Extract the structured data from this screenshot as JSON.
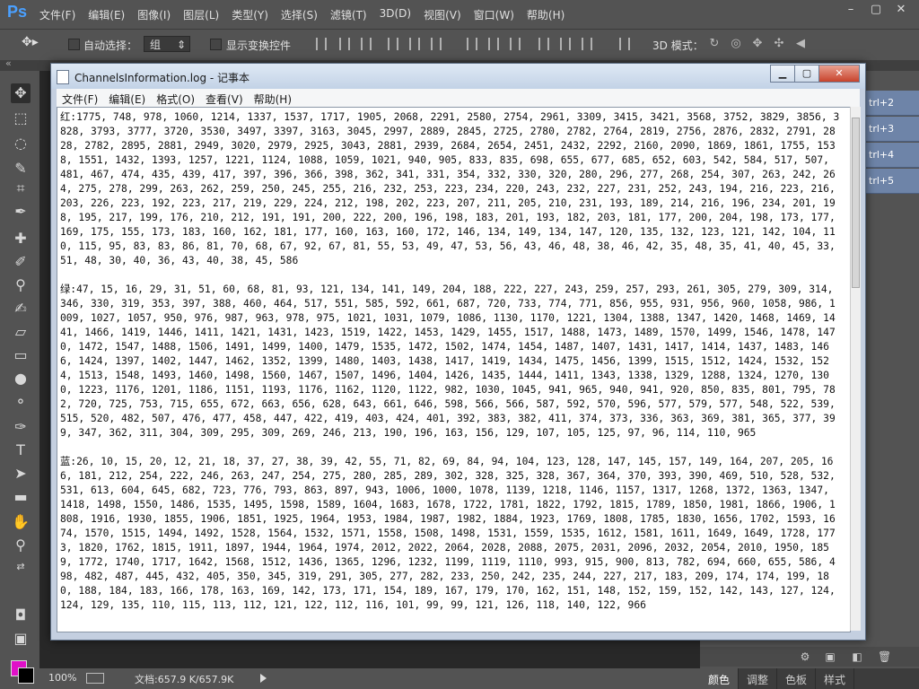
{
  "photoshop": {
    "logo": "Ps",
    "menu": [
      "文件(F)",
      "编辑(E)",
      "图像(I)",
      "图层(L)",
      "类型(Y)",
      "选择(S)",
      "滤镜(T)",
      "3D(D)",
      "视图(V)",
      "窗口(W)",
      "帮助(H)"
    ],
    "window_controls": [
      "–",
      "▢",
      "✕"
    ],
    "options": {
      "auto_select_label": "自动选择：",
      "auto_select_value": "组",
      "show_transform_label": "显示变换控件",
      "mode_3d_label": "3D 模式："
    },
    "tab_strip_label": "«",
    "actions": [
      "trl+2",
      "trl+3",
      "trl+4",
      "trl+5"
    ],
    "status": {
      "zoom": "100%",
      "doc_info": "文档:657.9 K/657.9K"
    },
    "panel_tabs": [
      "颜色",
      "调整",
      "色板",
      "样式"
    ],
    "colors": {
      "foreground": "#e010c8",
      "background": "#000000"
    }
  },
  "notepad": {
    "title": "ChannelsInformation.log - 记事本",
    "menu": [
      "文件(F)",
      "编辑(E)",
      "格式(O)",
      "查看(V)",
      "帮助(H)"
    ],
    "content": "红:1775, 748, 978, 1060, 1214, 1337, 1537, 1717, 1905, 2068, 2291, 2580, 2754, 2961, 3309, 3415, 3421, 3568, 3752, 3829, 3856, 3828, 3793, 3777, 3720, 3530, 3497, 3397, 3163, 3045, 2997, 2889, 2845, 2725, 2780, 2782, 2764, 2819, 2756, 2876, 2832, 2791, 2828, 2782, 2895, 2881, 2949, 3020, 2979, 2925, 3043, 2881, 2939, 2684, 2654, 2451, 2432, 2292, 2160, 2090, 1869, 1861, 1755, 1538, 1551, 1432, 1393, 1257, 1221, 1124, 1088, 1059, 1021, 940, 905, 833, 835, 698, 655, 677, 685, 652, 603, 542, 584, 517, 507, 481, 467, 474, 435, 439, 417, 397, 396, 366, 398, 362, 341, 331, 354, 332, 330, 320, 280, 296, 277, 268, 254, 307, 263, 242, 264, 275, 278, 299, 263, 262, 259, 250, 245, 255, 216, 232, 253, 223, 234, 220, 243, 232, 227, 231, 252, 243, 194, 216, 223, 216, 203, 226, 223, 192, 223, 217, 219, 229, 224, 212, 198, 202, 223, 207, 211, 205, 210, 231, 193, 189, 214, 216, 196, 234, 201, 198, 195, 217, 199, 176, 210, 212, 191, 191, 200, 222, 200, 196, 198, 183, 201, 193, 182, 203, 181, 177, 200, 204, 198, 173, 177, 169, 175, 155, 173, 183, 160, 162, 181, 177, 160, 163, 160, 172, 146, 134, 149, 134, 147, 120, 135, 132, 123, 121, 142, 104, 110, 115, 95, 83, 83, 86, 81, 70, 68, 67, 92, 67, 81, 55, 53, 49, 47, 53, 56, 43, 46, 48, 38, 46, 42, 35, 48, 35, 41, 40, 45, 33, 51, 48, 30, 40, 36, 43, 40, 38, 45, 586\n\n绿:47, 15, 16, 29, 31, 51, 60, 68, 81, 93, 121, 134, 141, 149, 204, 188, 222, 227, 243, 259, 257, 293, 261, 305, 279, 309, 314, 346, 330, 319, 353, 397, 388, 460, 464, 517, 551, 585, 592, 661, 687, 720, 733, 774, 771, 856, 955, 931, 956, 960, 1058, 986, 1009, 1027, 1057, 950, 976, 987, 963, 978, 975, 1021, 1031, 1079, 1086, 1130, 1170, 1221, 1304, 1388, 1347, 1420, 1468, 1469, 1441, 1466, 1419, 1446, 1411, 1421, 1431, 1423, 1519, 1422, 1453, 1429, 1455, 1517, 1488, 1473, 1489, 1570, 1499, 1546, 1478, 1470, 1472, 1547, 1488, 1506, 1491, 1499, 1400, 1479, 1535, 1472, 1502, 1474, 1454, 1487, 1407, 1431, 1417, 1414, 1437, 1483, 1466, 1424, 1397, 1402, 1447, 1462, 1352, 1399, 1480, 1403, 1438, 1417, 1419, 1434, 1475, 1456, 1399, 1515, 1512, 1424, 1532, 1524, 1513, 1548, 1493, 1460, 1498, 1560, 1467, 1507, 1496, 1404, 1426, 1435, 1444, 1411, 1343, 1338, 1329, 1288, 1324, 1270, 1300, 1223, 1176, 1201, 1186, 1151, 1193, 1176, 1162, 1120, 1122, 982, 1030, 1045, 941, 965, 940, 941, 920, 850, 835, 801, 795, 782, 720, 725, 753, 715, 655, 672, 663, 656, 628, 643, 661, 646, 598, 566, 566, 587, 592, 570, 596, 577, 579, 577, 548, 522, 539, 515, 520, 482, 507, 476, 477, 458, 447, 422, 419, 403, 424, 401, 392, 383, 382, 411, 374, 373, 336, 363, 369, 381, 365, 377, 399, 347, 362, 311, 304, 309, 295, 309, 269, 246, 213, 190, 196, 163, 156, 129, 107, 105, 125, 97, 96, 114, 110, 965\n\n蓝:26, 10, 15, 20, 12, 21, 18, 37, 27, 38, 39, 42, 55, 71, 82, 69, 84, 94, 104, 123, 128, 147, 145, 157, 149, 164, 207, 205, 166, 181, 212, 254, 222, 246, 263, 247, 254, 275, 280, 285, 289, 302, 328, 325, 328, 367, 364, 370, 393, 390, 469, 510, 528, 532, 531, 613, 604, 645, 682, 723, 776, 793, 863, 897, 943, 1006, 1000, 1078, 1139, 1218, 1146, 1157, 1317, 1268, 1372, 1363, 1347, 1418, 1498, 1550, 1486, 1535, 1495, 1598, 1589, 1604, 1683, 1678, 1722, 1781, 1822, 1792, 1815, 1789, 1850, 1981, 1866, 1906, 1808, 1916, 1930, 1855, 1906, 1851, 1925, 1964, 1953, 1984, 1987, 1982, 1884, 1923, 1769, 1808, 1785, 1830, 1656, 1702, 1593, 1674, 1570, 1515, 1494, 1492, 1528, 1564, 1532, 1571, 1558, 1508, 1498, 1531, 1559, 1535, 1612, 1581, 1611, 1649, 1649, 1728, 1773, 1820, 1762, 1815, 1911, 1897, 1944, 1964, 1974, 2012, 2022, 2064, 2028, 2088, 2075, 2031, 2096, 2032, 2054, 2010, 1950, 1859, 1772, 1740, 1717, 1642, 1568, 1512, 1436, 1365, 1296, 1232, 1199, 1119, 1110, 993, 915, 900, 813, 782, 694, 660, 655, 586, 498, 482, 487, 445, 432, 405, 350, 345, 319, 291, 305, 277, 282, 233, 250, 242, 235, 244, 227, 217, 183, 209, 174, 174, 199, 180, 188, 184, 183, 166, 178, 163, 169, 142, 173, 171, 154, 189, 167, 179, 170, 162, 151, 148, 152, 159, 152, 142, 143, 127, 124, 124, 129, 135, 110, 115, 113, 112, 121, 122, 112, 116, 101, 99, 99, 121, 126, 118, 140, 122, 966"
  }
}
